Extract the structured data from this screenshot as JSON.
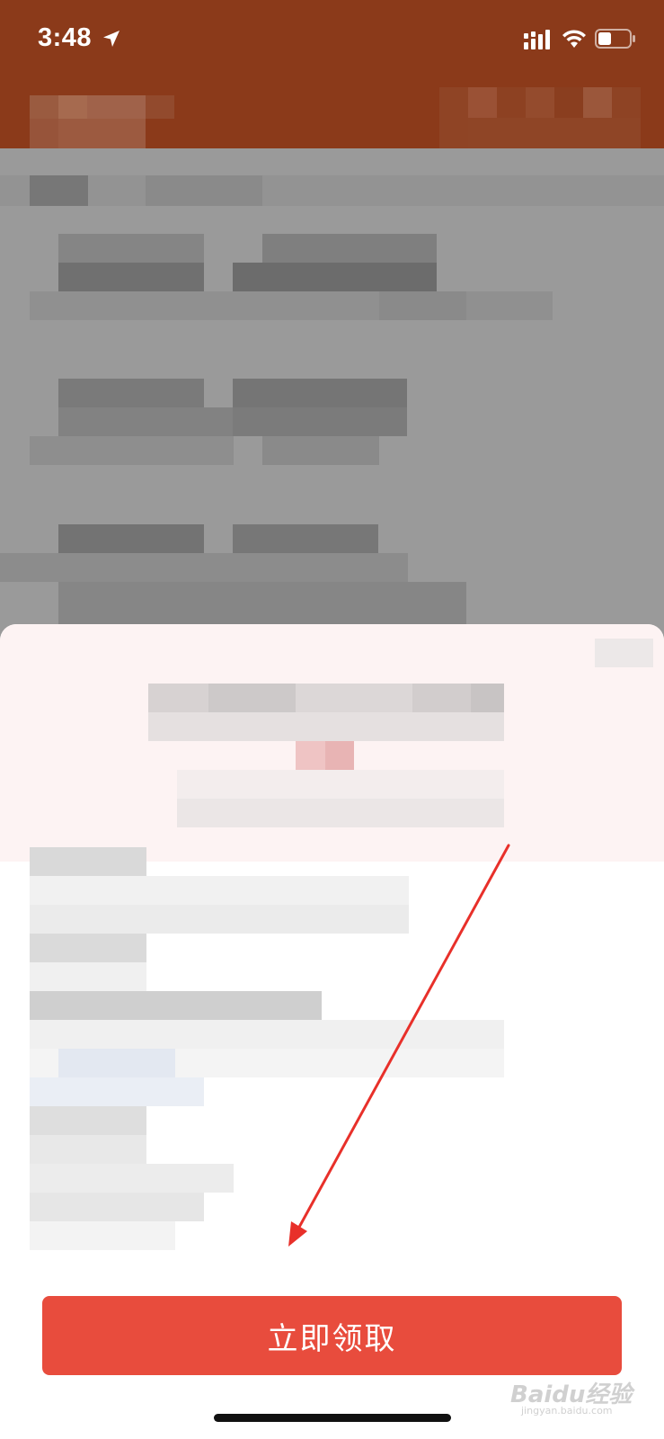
{
  "status_bar": {
    "time": "3:48",
    "location_icon": "location-arrow-icon",
    "signal_icon": "cellular-signal-icon",
    "wifi_icon": "wifi-icon",
    "battery_icon": "battery-icon"
  },
  "action": {
    "claim_label": "立即领取"
  },
  "watermark": {
    "main": "Baidu经验",
    "sub": "jingyan.baidu.com"
  },
  "colors": {
    "header": "#8b3a1a",
    "overlay": "#9a9a9a",
    "button": "#e84c3d",
    "annotation_arrow": "#e8302a"
  }
}
